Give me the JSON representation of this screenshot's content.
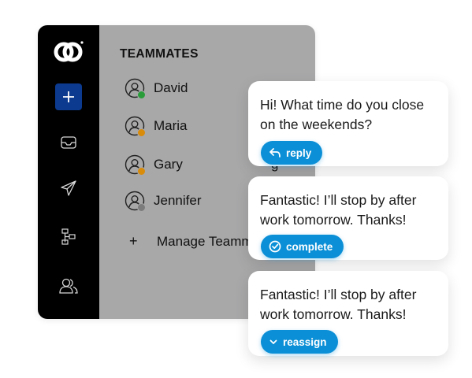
{
  "sidebar": {
    "icons": [
      "logo-icon",
      "plus-icon",
      "inbox-icon",
      "send-icon",
      "workflow-icon",
      "contacts-icon"
    ],
    "accent_color": "#0b3a8f"
  },
  "panel": {
    "title": "TEAMMATES",
    "teammates": [
      {
        "name": "David",
        "status_color": "#2a9d3a"
      },
      {
        "name": "Maria",
        "status_color": "#d98b0a"
      },
      {
        "name": "Gary",
        "status_color": "#d98b0a"
      },
      {
        "name": "Jennifer",
        "status_color": "#7c7c7c"
      }
    ],
    "manage_label": "Manage Teamm",
    "manage_prefix": "+",
    "partial_text": "g"
  },
  "messages": [
    {
      "text": "Hi! What time do you close on the weekends?",
      "action": "reply",
      "action_icon": "reply-icon"
    },
    {
      "text": "Fantastic! I’ll stop by after work tomorrow. Thanks!",
      "action": "complete",
      "action_icon": "check-circle-icon"
    },
    {
      "text": "Fantastic! I’ll stop by after work tomorrow. Thanks!",
      "action": "reassign",
      "action_icon": "chevron-down-icon"
    }
  ],
  "colors": {
    "action_pill": "#0b8fd6",
    "panel_bg": "#a8a8a9",
    "rail_bg": "#000000"
  }
}
